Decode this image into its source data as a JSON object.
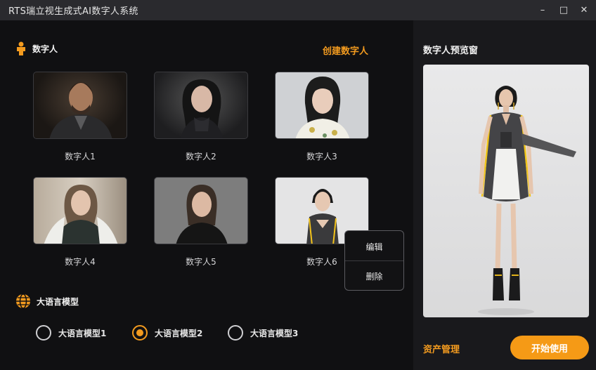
{
  "window": {
    "title": "RTS瑞立视生成式AI数字人系统",
    "minimize": "–",
    "maximize": "□",
    "close": "✕"
  },
  "digital_humans": {
    "section_title": "数字人",
    "section_icon": "person-icon",
    "create_label": "创建数字人",
    "items": [
      {
        "label": "数字人1"
      },
      {
        "label": "数字人2"
      },
      {
        "label": "数字人3"
      },
      {
        "label": "数字人4"
      },
      {
        "label": "数字人5"
      },
      {
        "label": "数字人6"
      }
    ],
    "context_menu": {
      "edit": "编辑",
      "delete": "删除"
    }
  },
  "llm": {
    "section_title": "大语言模型",
    "section_icon": "globe-icon",
    "options": [
      {
        "label": "大语言模型1",
        "selected": false
      },
      {
        "label": "大语言模型2",
        "selected": true
      },
      {
        "label": "大语言模型3",
        "selected": false
      }
    ]
  },
  "preview": {
    "title": "数字人预览窗",
    "asset_label": "资产管理",
    "start_label": "开始使用"
  },
  "colors": {
    "accent": "#f39b1f",
    "background": "#101012",
    "panel": "#19191c",
    "titlebar": "#2a2a2e"
  }
}
